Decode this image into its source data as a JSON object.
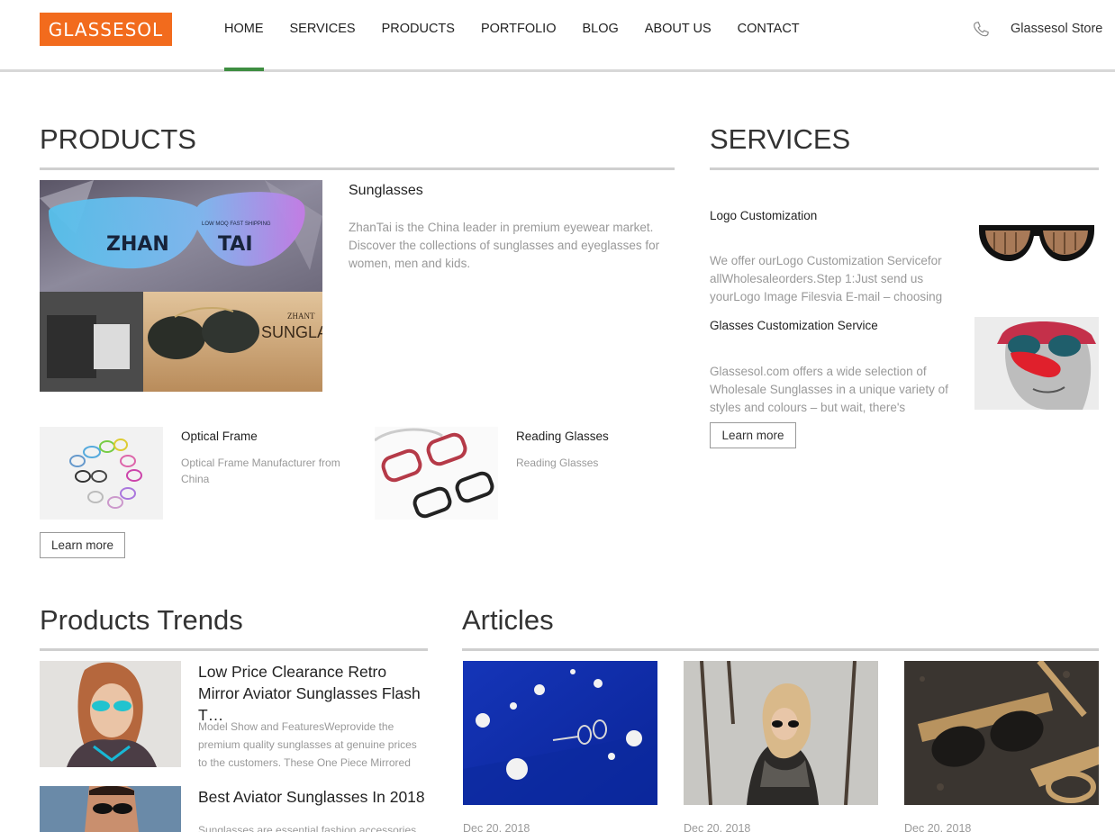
{
  "header": {
    "logo": "GLASSESOL",
    "nav": [
      "HOME",
      "SERVICES",
      "PRODUCTS",
      "PORTFOLIO",
      "BLOG",
      "ABOUT US",
      "CONTACT"
    ],
    "active_nav": "HOME",
    "store": "Glassesol Store"
  },
  "products": {
    "heading": "PRODUCTS",
    "featured": {
      "title": "Sunglasses",
      "desc": "ZhanTai is the China leader in premium eyewear market. Discover the collections of sunglasses and eyeglasses for women, men and kids.",
      "banner_text_left": "ZHAN",
      "banner_text_right": "TAI",
      "banner_tag": "LOW MOQ FAST SHIPPING",
      "banner_sub": "SUNGLA",
      "banner_brand": "ZHANT"
    },
    "items": [
      {
        "title": "Optical Frame",
        "desc": "Optical Frame Manufacturer from China"
      },
      {
        "title": "Reading Glasses",
        "desc": "Reading Glasses"
      }
    ],
    "learn_more": "Learn more"
  },
  "services": {
    "heading": "SERVICES",
    "items": [
      {
        "title": "Logo Customization",
        "desc": "We offer ourLogo Customization Servicefor allWholesaleorders.Step 1:Just send us yourLogo Image Filesvia E-mail – choosing"
      },
      {
        "title": "Glasses Customization Service",
        "desc": "Glassesol.com offers a wide selection of Wholesale Sunglasses in a unique variety of styles and colours – but wait, there's"
      }
    ],
    "learn_more": "Learn more"
  },
  "trends": {
    "heading": "Products Trends",
    "items": [
      {
        "title": "Low Price Clearance Retro Mirror Aviator Sunglasses Flash T…",
        "desc": "Model Show and FeaturesWeprovide the premium quality sunglasses at genuine prices to the customers. These One Piece Mirrored Sunglass…"
      },
      {
        "title": "Best Aviator Sunglasses In 2018",
        "desc": "Sunglasses are essential fashion accessories for"
      }
    ]
  },
  "articles": {
    "heading": "Articles",
    "dates": [
      "Dec 20, 2018",
      "Dec 20, 2018",
      "Dec 20, 2018"
    ]
  },
  "colors": {
    "brand": "#f26b1d",
    "nav_active": "#3e8e41",
    "rule": "#cfcfcf"
  }
}
